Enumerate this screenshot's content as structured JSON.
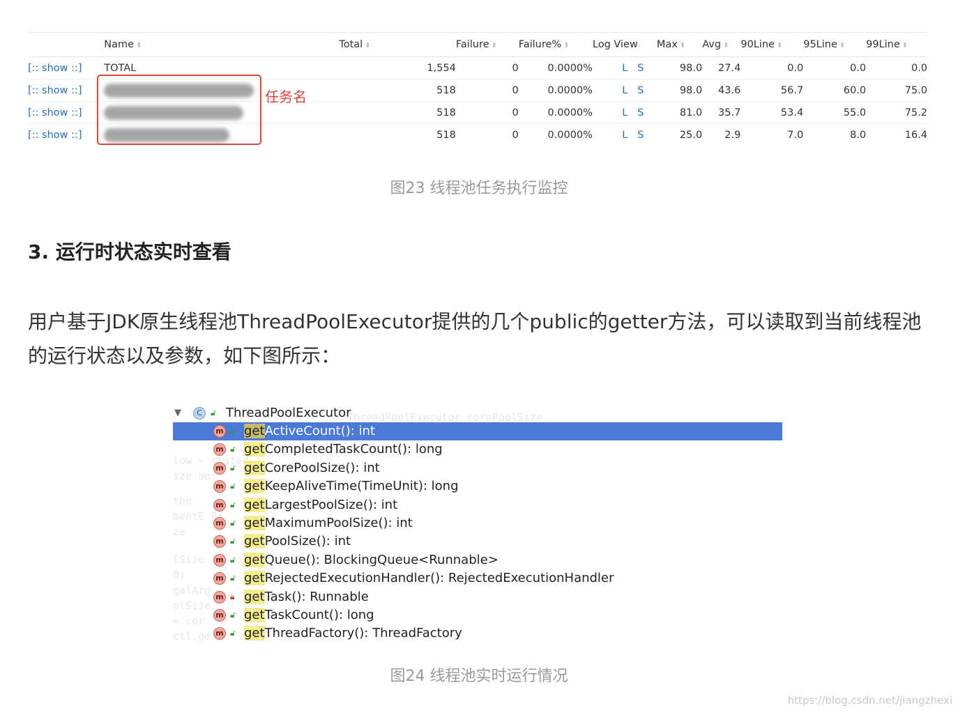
{
  "fig23": {
    "headers": {
      "name": "Name",
      "total": "Total",
      "failure": "Failure",
      "failure_pct": "Failure%",
      "log_view": "Log View",
      "max": "Max",
      "avg": "Avg",
      "line90": "90Line",
      "line95": "95Line",
      "line99": "99Line"
    },
    "rows": [
      {
        "show": "[:: show ::]",
        "name": "TOTAL",
        "total": "1,554",
        "failure": "0",
        "failure_pct": "0.0000%",
        "l": "L",
        "s": "S",
        "max": "98.0",
        "avg": "27.4",
        "l90": "0.0",
        "l95": "0.0",
        "l99": "0.0"
      },
      {
        "show": "[:: show ::]",
        "name": "",
        "total": "518",
        "failure": "0",
        "failure_pct": "0.0000%",
        "l": "L",
        "s": "S",
        "max": "98.0",
        "avg": "43.6",
        "l90": "56.7",
        "l95": "60.0",
        "l99": "75.0"
      },
      {
        "show": "[:: show ::]",
        "name": "",
        "total": "518",
        "failure": "0",
        "failure_pct": "0.0000%",
        "l": "L",
        "s": "S",
        "max": "81.0",
        "avg": "35.7",
        "l90": "53.4",
        "l95": "55.0",
        "l99": "75.2"
      },
      {
        "show": "[:: show ::]",
        "name": "",
        "total": "518",
        "failure": "0",
        "failure_pct": "0.0000%",
        "l": "L",
        "s": "S",
        "max": "25.0",
        "avg": "2.9",
        "l90": "7.0",
        "l95": "8.0",
        "l99": "16.4"
      }
    ],
    "annotation": "任务名",
    "caption": "图23 线程池任务执行监控"
  },
  "section": {
    "heading": "3. 运行时状态实时查看",
    "paragraph": "用户基于JDK原生线程池ThreadPoolExecutor提供的几个public的getter方法，可以读取到当前线程池的运行状态以及参数，如下图所示："
  },
  "fig24": {
    "class_name": "ThreadPoolExecutor",
    "prefix": "get",
    "methods": [
      {
        "rest": "ActiveCount(): int",
        "access": "public"
      },
      {
        "rest": "CompletedTaskCount(): long",
        "access": "public"
      },
      {
        "rest": "CorePoolSize(): int",
        "access": "public"
      },
      {
        "rest": "KeepAliveTime(TimeUnit): long",
        "access": "public"
      },
      {
        "rest": "LargestPoolSize(): int",
        "access": "public"
      },
      {
        "rest": "MaximumPoolSize(): int",
        "access": "public"
      },
      {
        "rest": "PoolSize(): int",
        "access": "public"
      },
      {
        "rest": "Queue(): BlockingQueue<Runnable>",
        "access": "public"
      },
      {
        "rest": "RejectedExecutionHandler(): RejectedExecutionHandler",
        "access": "public"
      },
      {
        "rest": "Task(): Runnable",
        "access": "private"
      },
      {
        "rest": "TaskCount(): long",
        "access": "public"
      },
      {
        "rest": "ThreadFactory(): ThreadFactory",
        "access": "public"
      }
    ],
    "caption": "图24 线程池实时运行情况"
  },
  "watermark": "https://blog.csdn.net/jiangzhexi",
  "colors": {
    "selection": "#4a7ad6",
    "annotation": "#e1443a",
    "link": "#2a6fb6"
  }
}
